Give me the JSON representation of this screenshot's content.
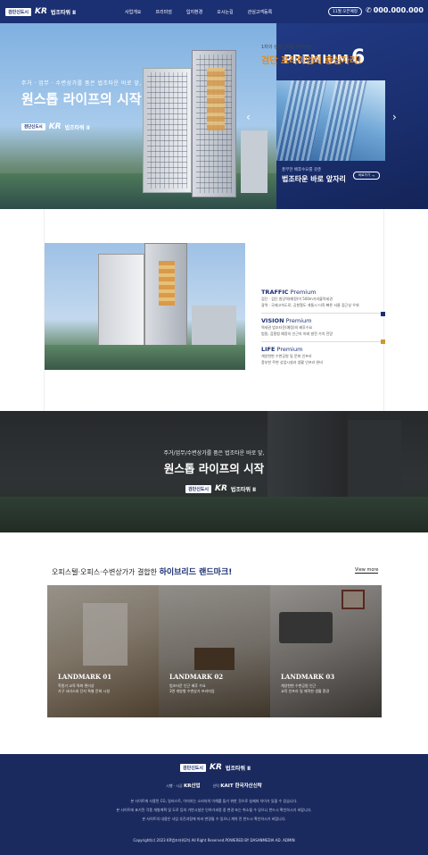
{
  "header": {
    "badge": "검단신도시",
    "brand_kr": "KR",
    "brand_name": "법조타워 Ⅱ",
    "nav": [
      "사업개요",
      "프리미엄",
      "입지환경",
      "오시는길",
      "관심고객등록"
    ],
    "open_badge": "11월 오픈예정",
    "phone": "000.000.000"
  },
  "hero": {
    "subtitle": "주거 · 업무 · 수변상가를 품은 법조타운 바로 앞,",
    "title": "원스톱 라이프의 시작",
    "badge": "검단신도시",
    "brand_kr": "KR",
    "brand_name": "법조타워 Ⅱ"
  },
  "premium": {
    "title": "PREMIUM",
    "number": "6",
    "caption": "풍부한 배후수요를 갖춘",
    "headline": "법조타운 바로 앞자리",
    "more_label": "바로가기"
  },
  "center": {
    "eyebrow": "1차의 성공신화를 이어가는",
    "title": "검단 프리미엄의 중심자리!",
    "features": [
      {
        "name_bold": "TRAFFIC",
        "name_rest": " Premium",
        "lines": [
          "검단 · 검단 원당역(예정)이 500m거리블럭세권",
          "광역 · 국제고속도로, 공항철도 개통시 더욱 빠른 서울 접근성 우위"
        ]
      },
      {
        "name_bold": "VISION",
        "name_rest": " Premium",
        "lines": [
          "역세권 법조타운(예정)의 배후수요",
          "법원, 검찰청 예정지 인근의 미래 발전 가치 전망"
        ]
      },
      {
        "name_bold": "LIFE",
        "name_rest": " Premium",
        "lines": [
          "계양천변 수변공원 및 문화 인프라",
          "풍부한 주변 상업시설과 생활 인프라 완비"
        ]
      }
    ]
  },
  "band": {
    "subtitle": "주거/업무/수변상가를 품은 법조타운 바로 앞,",
    "title": "원스톱 라이프의 시작",
    "badge": "검단신도시",
    "brand_kr": "KR",
    "brand_name": "법조타워 Ⅱ"
  },
  "landmark": {
    "title_pre": "오피스텔·오피스·수변상가가 결합한 ",
    "title_bold": "하이브리드 랜드마크!",
    "view_more": "View more",
    "panels": [
      {
        "label": "LANDMARK 01",
        "lines": [
          "학원가 교육 특화 편리성",
          "가구 서비스와 단지 특별 문화 시설"
        ]
      },
      {
        "label": "LANDMARK 02",
        "lines": [
          "법조타운 인근 배후 수요",
          "3면 개방형 수변상가 프리미엄"
        ]
      },
      {
        "label": "LANDMARK 03",
        "lines": [
          "계양천변 수변공원 인근",
          "교육 인프라 및 쾌적한 생활 환경"
        ]
      }
    ]
  },
  "footer": {
    "badge": "검단신도시",
    "brand_kr": "KR",
    "brand_name": "법조타워 Ⅱ",
    "developer_label": "시행 · 시공",
    "developer_name": "KR산업",
    "trust_label": "신탁",
    "trust_name": "KAIT 한국자산신탁",
    "notices": [
      "본 사이트에 사용된 CG, 일러스트, 이미지는 소비자의 이해를 돕기 위한 것으로 실제와 차이가 있을 수 있습니다.",
      "본 사이트에 표기된 각종 개발계획 및 도로 등의 기반시설은 인허가과정 중 변경 또는 취소될 수 있으니 반드시 확인하시기 바랍니다.",
      "본 사이트의 내용은 사업 추진과정에 따라 변경될 수 있으니 계약 전 반드시 확인하시기 바랍니다."
    ],
    "copyright": "Copyright(c) 2023 KR법조타워2차 All Right Reserved.POWERED BY DASANMEDIA AD. ADMIN"
  }
}
